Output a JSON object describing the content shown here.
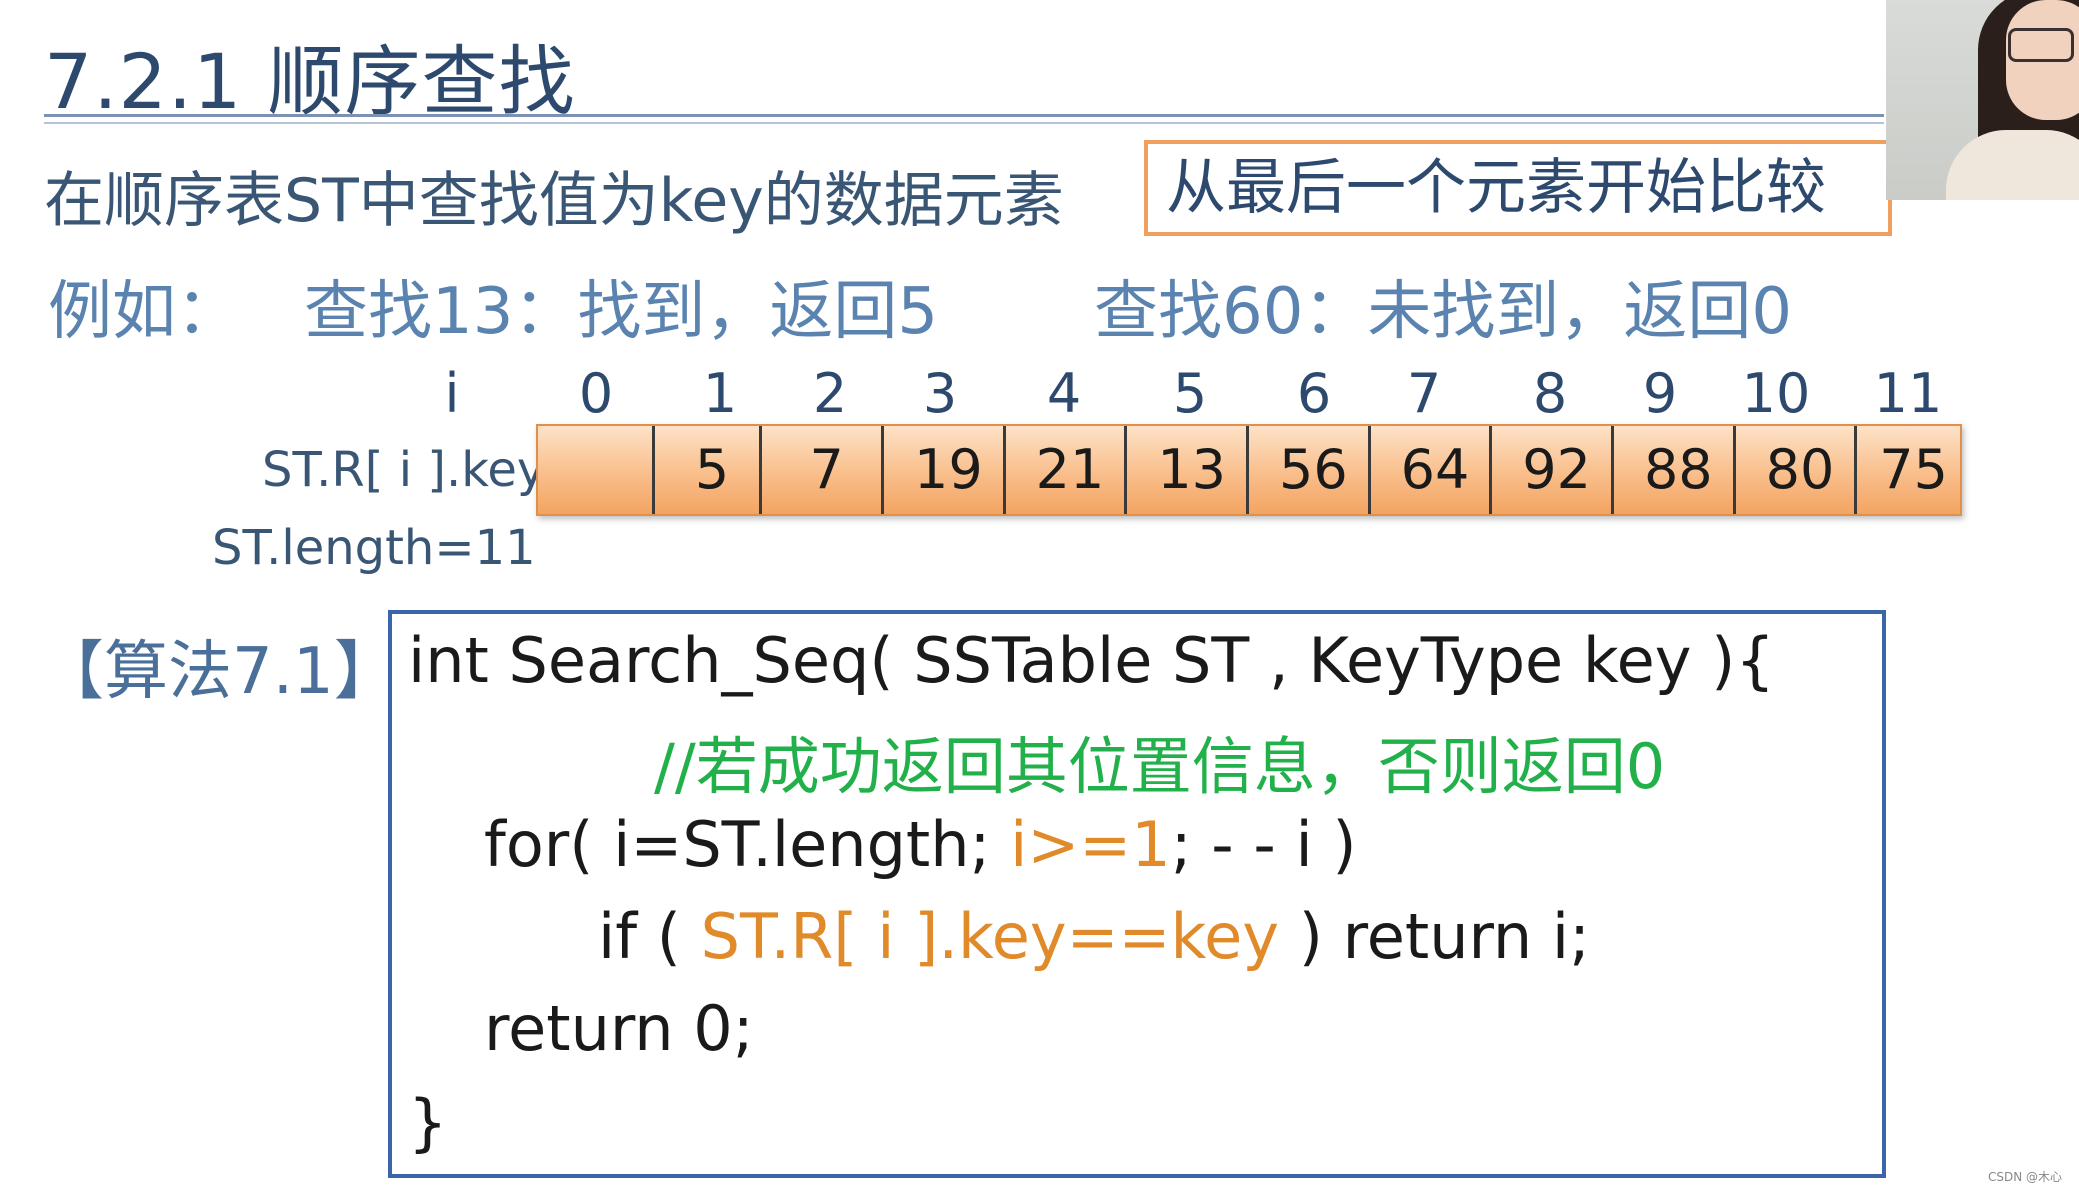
{
  "title": "7.2.1 顺序查找",
  "subtitle": "在顺序表ST中查找值为key的数据元素",
  "callout": "从最后一个元素开始比较",
  "example": {
    "label": "例如：",
    "case_found": "查找13：找到，返回5",
    "case_not_found": "查找60：未找到，返回0"
  },
  "table": {
    "index_label": "i",
    "indices": [
      "0",
      "1",
      "2",
      "3",
      "4",
      "5",
      "6",
      "7",
      "8",
      "9",
      "10",
      "11"
    ],
    "row_label": "ST.R[ i ].key",
    "keys": [
      "",
      "5",
      "7",
      "19",
      "21",
      "13",
      "56",
      "64",
      "92",
      "88",
      "80",
      "75"
    ],
    "length_label": "ST.length=11"
  },
  "algorithm": {
    "label": "【算法7.1】",
    "lines": {
      "l1": "int Search_Seq( SSTable  ST , KeyType  key ){",
      "l2": "//若成功返回其位置信息，否则返回0",
      "l3_a": "for( i=ST.length;  ",
      "l3_b": "i>=1",
      "l3_c": ";  - - i  )",
      "l4_a": "if  ( ",
      "l4_b": "ST.R[ i ].key==key",
      "l4_c": " )   return i;",
      "l5": "return 0;",
      "l6": "}"
    }
  },
  "watermark": "CSDN @木心",
  "colors": {
    "title": "#2d4a6e",
    "example": "#5b83b0",
    "comment": "#22b04a",
    "highlight": "#e08a2a",
    "code_border": "#3c64a8",
    "callout_border": "#f0a05c",
    "cell_fill": "#f9be8a"
  }
}
